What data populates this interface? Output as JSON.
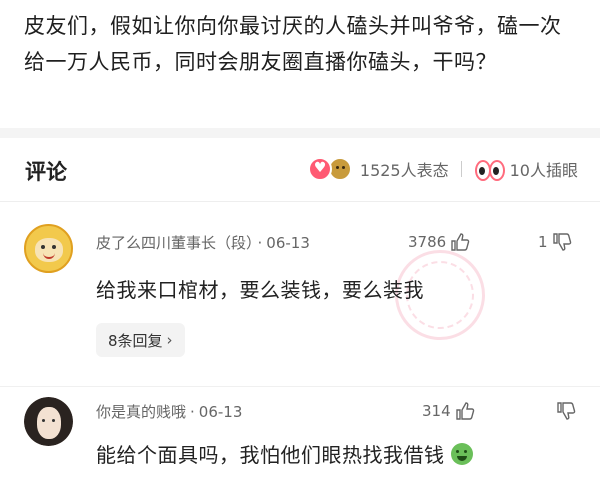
{
  "post": {
    "text": "皮友们，假如让你向你最讨厌的人磕头并叫爷爷，磕一次给一万人民币，同时会朋友圈直播你磕头，干吗？"
  },
  "comments_header": {
    "title": "评论",
    "reactions_text": "1525人表态",
    "interjections_text": "10人插眼"
  },
  "comments": [
    {
      "author": "皮了么四川董事长（段）",
      "date": "06-13",
      "likes": "3786",
      "dislikes": "1",
      "text": "给我来口棺材，要么装钱，要么装我",
      "replies_label": "8条回复",
      "avatar": "monkey-avatar"
    },
    {
      "author": "你是真的贱哦",
      "date": "06-13",
      "likes": "314",
      "dislikes": "",
      "text": "能给个面具吗，我怕他们眼热找我借钱",
      "emoji": "nauseated-face-emoji",
      "avatar": "girl-avatar"
    }
  ],
  "colors": {
    "accent_pink": "#ff5a73",
    "section_gray": "#f4f4f4"
  }
}
